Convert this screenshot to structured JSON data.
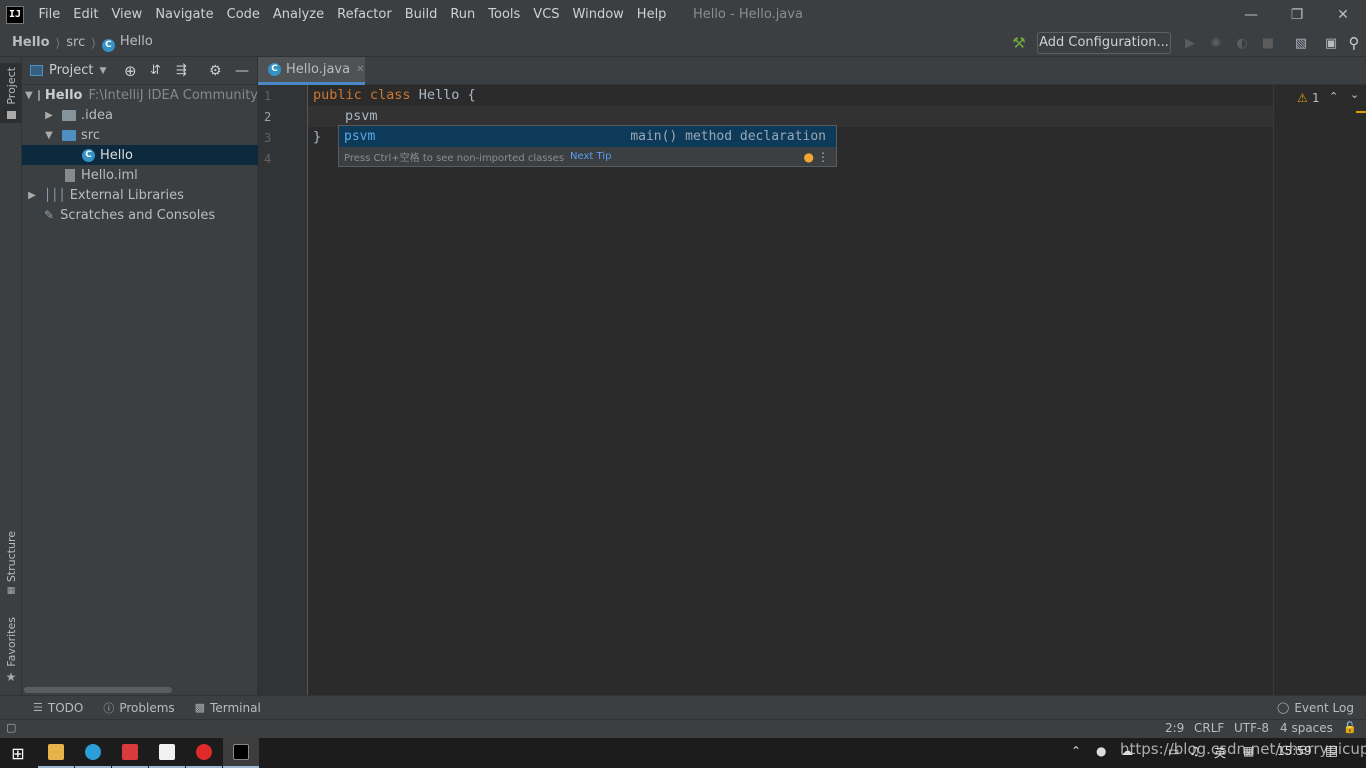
{
  "app": {
    "logo_text": "IJ",
    "window_title": "Hello - Hello.java",
    "menu": [
      "File",
      "Edit",
      "View",
      "Navigate",
      "Code",
      "Analyze",
      "Refactor",
      "Build",
      "Run",
      "Tools",
      "VCS",
      "Window",
      "Help"
    ]
  },
  "navbar": {
    "crumbs": [
      "Hello",
      "src",
      "Hello"
    ],
    "add_configuration": "Add Configuration..."
  },
  "left_strip": {
    "tabs": [
      "Project",
      "Structure",
      "Favorites"
    ]
  },
  "project_panel": {
    "title": "Project",
    "tree": [
      {
        "label": "Hello",
        "extra": "F:\\IntelliJ IDEA Community",
        "expanded": true
      },
      {
        "label": ".idea",
        "expanded": false
      },
      {
        "label": "src",
        "expanded": true
      },
      {
        "label": "Hello",
        "selected": true
      },
      {
        "label": "Hello.iml"
      },
      {
        "label": "External Libraries",
        "expanded": false
      },
      {
        "label": "Scratches and Consoles"
      }
    ]
  },
  "editor": {
    "tab_label": "Hello.java",
    "line_numbers": [
      "1",
      "2",
      "3",
      "4"
    ],
    "lines": {
      "l1_kw1": "public",
      "l1_kw2": "class",
      "l1_name": "Hello",
      "l1_brace": "{",
      "l2": "psvm",
      "l3": "}"
    },
    "inspection_count": "1"
  },
  "completion": {
    "item": "psvm",
    "description": "main() method declaration",
    "footer_text": "Press Ctrl+空格 to see non-imported classes",
    "footer_link": "Next Tip"
  },
  "bottom_tools": [
    "TODO",
    "Problems",
    "Terminal"
  ],
  "event_log": "Event Log",
  "status": {
    "position": "2:9",
    "line_sep": "CRLF",
    "encoding": "UTF-8",
    "indent": "4 spaces"
  },
  "taskbar": {
    "clock": "15:59",
    "ime": "英"
  },
  "watermark": "https://blog.csdn.net/cherrypicup",
  "colors": {
    "keyword": "#cc7832",
    "class_name": "#a9b7c6",
    "accent": "#4a88c7"
  }
}
